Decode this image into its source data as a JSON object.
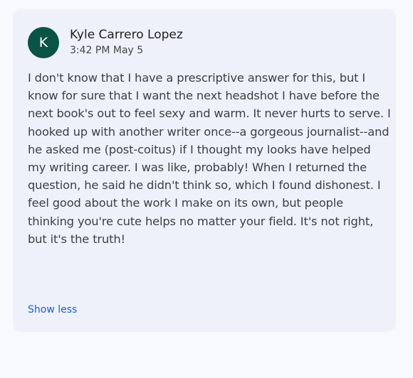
{
  "comment": {
    "avatar_initial": "K",
    "author": "Kyle Carrero Lopez",
    "timestamp": "3:42 PM May 5",
    "text": "I don't know that I have a prescriptive answer for this, but I know for sure that I want the next headshot I have before the next book's out to feel sexy and warm. It never hurts to serve. I hooked up with another writer once--a gorgeous journalist--and he asked me (post-coitus) if I thought my looks have helped my writing career. I was like, probably! When I returned the question, he said he didn't think so, which I found dishonest. I feel good about the work I make on its own, but people thinking you're cute helps no matter your field. It's not right, but it's the truth!",
    "show_less_label": "Show less"
  },
  "colors": {
    "page_background": "#f8f9fd",
    "card_background": "#eef1fa",
    "avatar_background": "#0b5344",
    "link": "#1a5fc7"
  }
}
